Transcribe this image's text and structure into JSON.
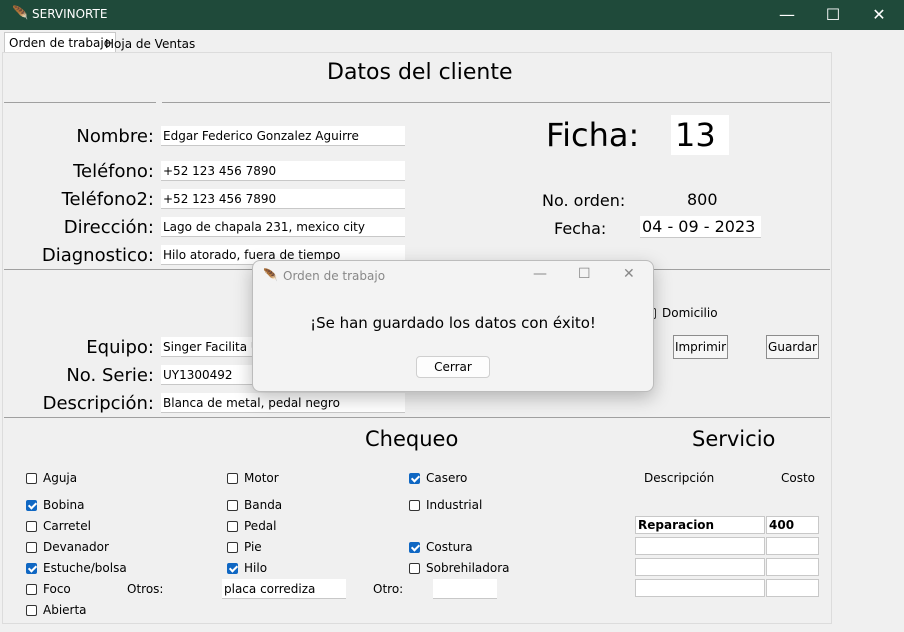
{
  "window": {
    "title": "SERVINORTE",
    "minimize": "—",
    "maximize": "☐",
    "close": "✕"
  },
  "tabs": [
    "Orden de trabajo",
    "Hoja de Ventas"
  ],
  "section_cliente": "Datos del cliente",
  "cliente": {
    "nombre_label": "Nombre:",
    "nombre": "Edgar Federico Gonzalez Aguirre",
    "telefono_label": "Teléfono:",
    "telefono": "+52 123 456 7890",
    "telefono2_label": "Teléfono2:",
    "telefono2": "+52 123 456 7890",
    "direccion_label": "Dirección:",
    "direccion": "Lago de chapala 231, mexico city",
    "diagnostico_label": "Diagnostico:",
    "diagnostico": "Hilo atorado, fuera de tiempo"
  },
  "ficha": {
    "label": "Ficha:",
    "value": "13"
  },
  "orden": {
    "label": "No. orden:",
    "value": "800"
  },
  "fecha": {
    "label": "Fecha:",
    "value": "04 - 09 - 2023"
  },
  "domicilio": {
    "label": "Domicilio",
    "checked": false
  },
  "buttons": {
    "imprimir": "Imprimir",
    "guardar": "Guardar"
  },
  "equipo": {
    "equipo_label": "Equipo:",
    "equipo": "Singer Facilita Ul",
    "serie_label": "No. Serie:",
    "serie": "UY1300492",
    "descripcion_label": "Descripción:",
    "descripcion": "Blanca de metal, pedal negro"
  },
  "section_chequeo": "Chequeo",
  "section_servicio": "Servicio",
  "chequeo": {
    "aguja": "Aguja",
    "bobina": "Bobina",
    "carretel": "Carretel",
    "devanador": "Devanador",
    "estuche": "Estuche/bolsa",
    "foco": "Foco",
    "abierta": "Abierta",
    "motor": "Motor",
    "banda": "Banda",
    "pedal": "Pedal",
    "pie": "Pie",
    "hilo": "Hilo",
    "casero": "Casero",
    "industrial": "Industrial",
    "costura": "Costura",
    "sobrehiladora": "Sobrehiladora",
    "otros_label": "Otros:",
    "otros_value": "placa corrediza",
    "otro_label": "Otro:",
    "otro_value": ""
  },
  "servicio": {
    "desc_header": "Descripción",
    "costo_header": "Costo",
    "rows": [
      {
        "descripcion": "Reparacion",
        "costo": "400"
      },
      {
        "descripcion": "",
        "costo": ""
      },
      {
        "descripcion": "",
        "costo": ""
      },
      {
        "descripcion": "",
        "costo": ""
      }
    ]
  },
  "dialog": {
    "title": "Orden de trabajo",
    "message": "¡Se han guardado los datos con éxito!",
    "button": "Cerrar",
    "minimize": "—",
    "maximize": "☐",
    "close": "✕"
  }
}
